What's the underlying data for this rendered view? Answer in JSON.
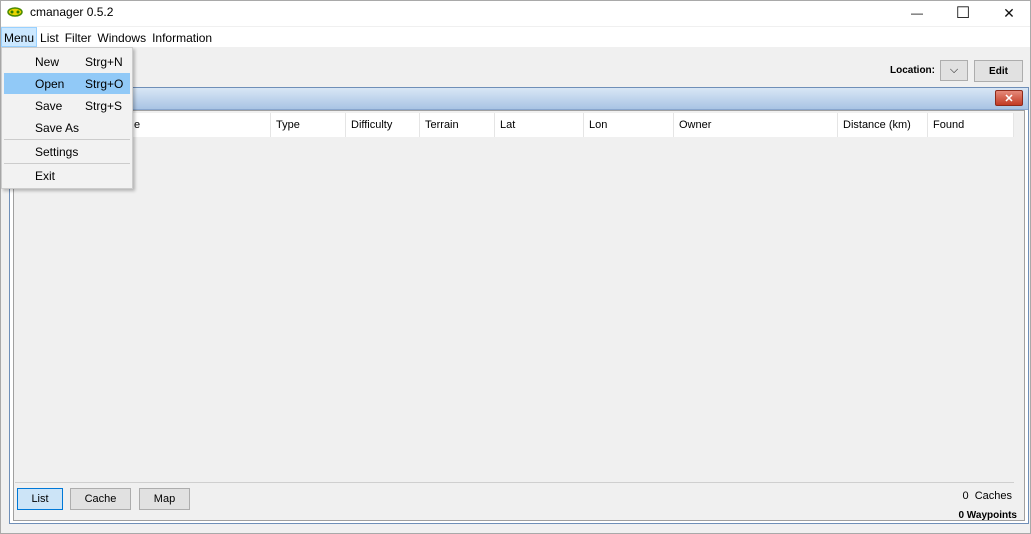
{
  "window": {
    "title": "cmanager 0.5.2",
    "min_symbol": "—",
    "max_symbol": "☐",
    "close_symbol": "✕"
  },
  "menubar": {
    "items": [
      "Menu",
      "List",
      "Filter",
      "Windows",
      "Information"
    ]
  },
  "toolbar": {
    "location_label": "Location:",
    "location_dropdown_symbol": "⌵",
    "edit_label": "Edit"
  },
  "menu": {
    "items": [
      {
        "label": "New",
        "shortcut": "Strg+N"
      },
      {
        "label": "Open",
        "shortcut": "Strg+O"
      },
      {
        "label": "Save",
        "shortcut": "Strg+S"
      },
      {
        "label": "Save As",
        "shortcut": ""
      },
      {
        "label": "Settings",
        "shortcut": ""
      },
      {
        "label": "Exit",
        "shortcut": ""
      }
    ]
  },
  "inner_window": {
    "close_symbol": "✕"
  },
  "table": {
    "columns": [
      "e",
      "Type",
      "Difficulty",
      "Terrain",
      "Lat",
      "Lon",
      "Owner",
      "Distance (km)",
      "Found"
    ]
  },
  "bottom": {
    "buttons": [
      "List",
      "Cache",
      "Map"
    ],
    "caches_count": "0",
    "caches_label": "Caches",
    "waypoints_text": "0 Waypoints"
  }
}
